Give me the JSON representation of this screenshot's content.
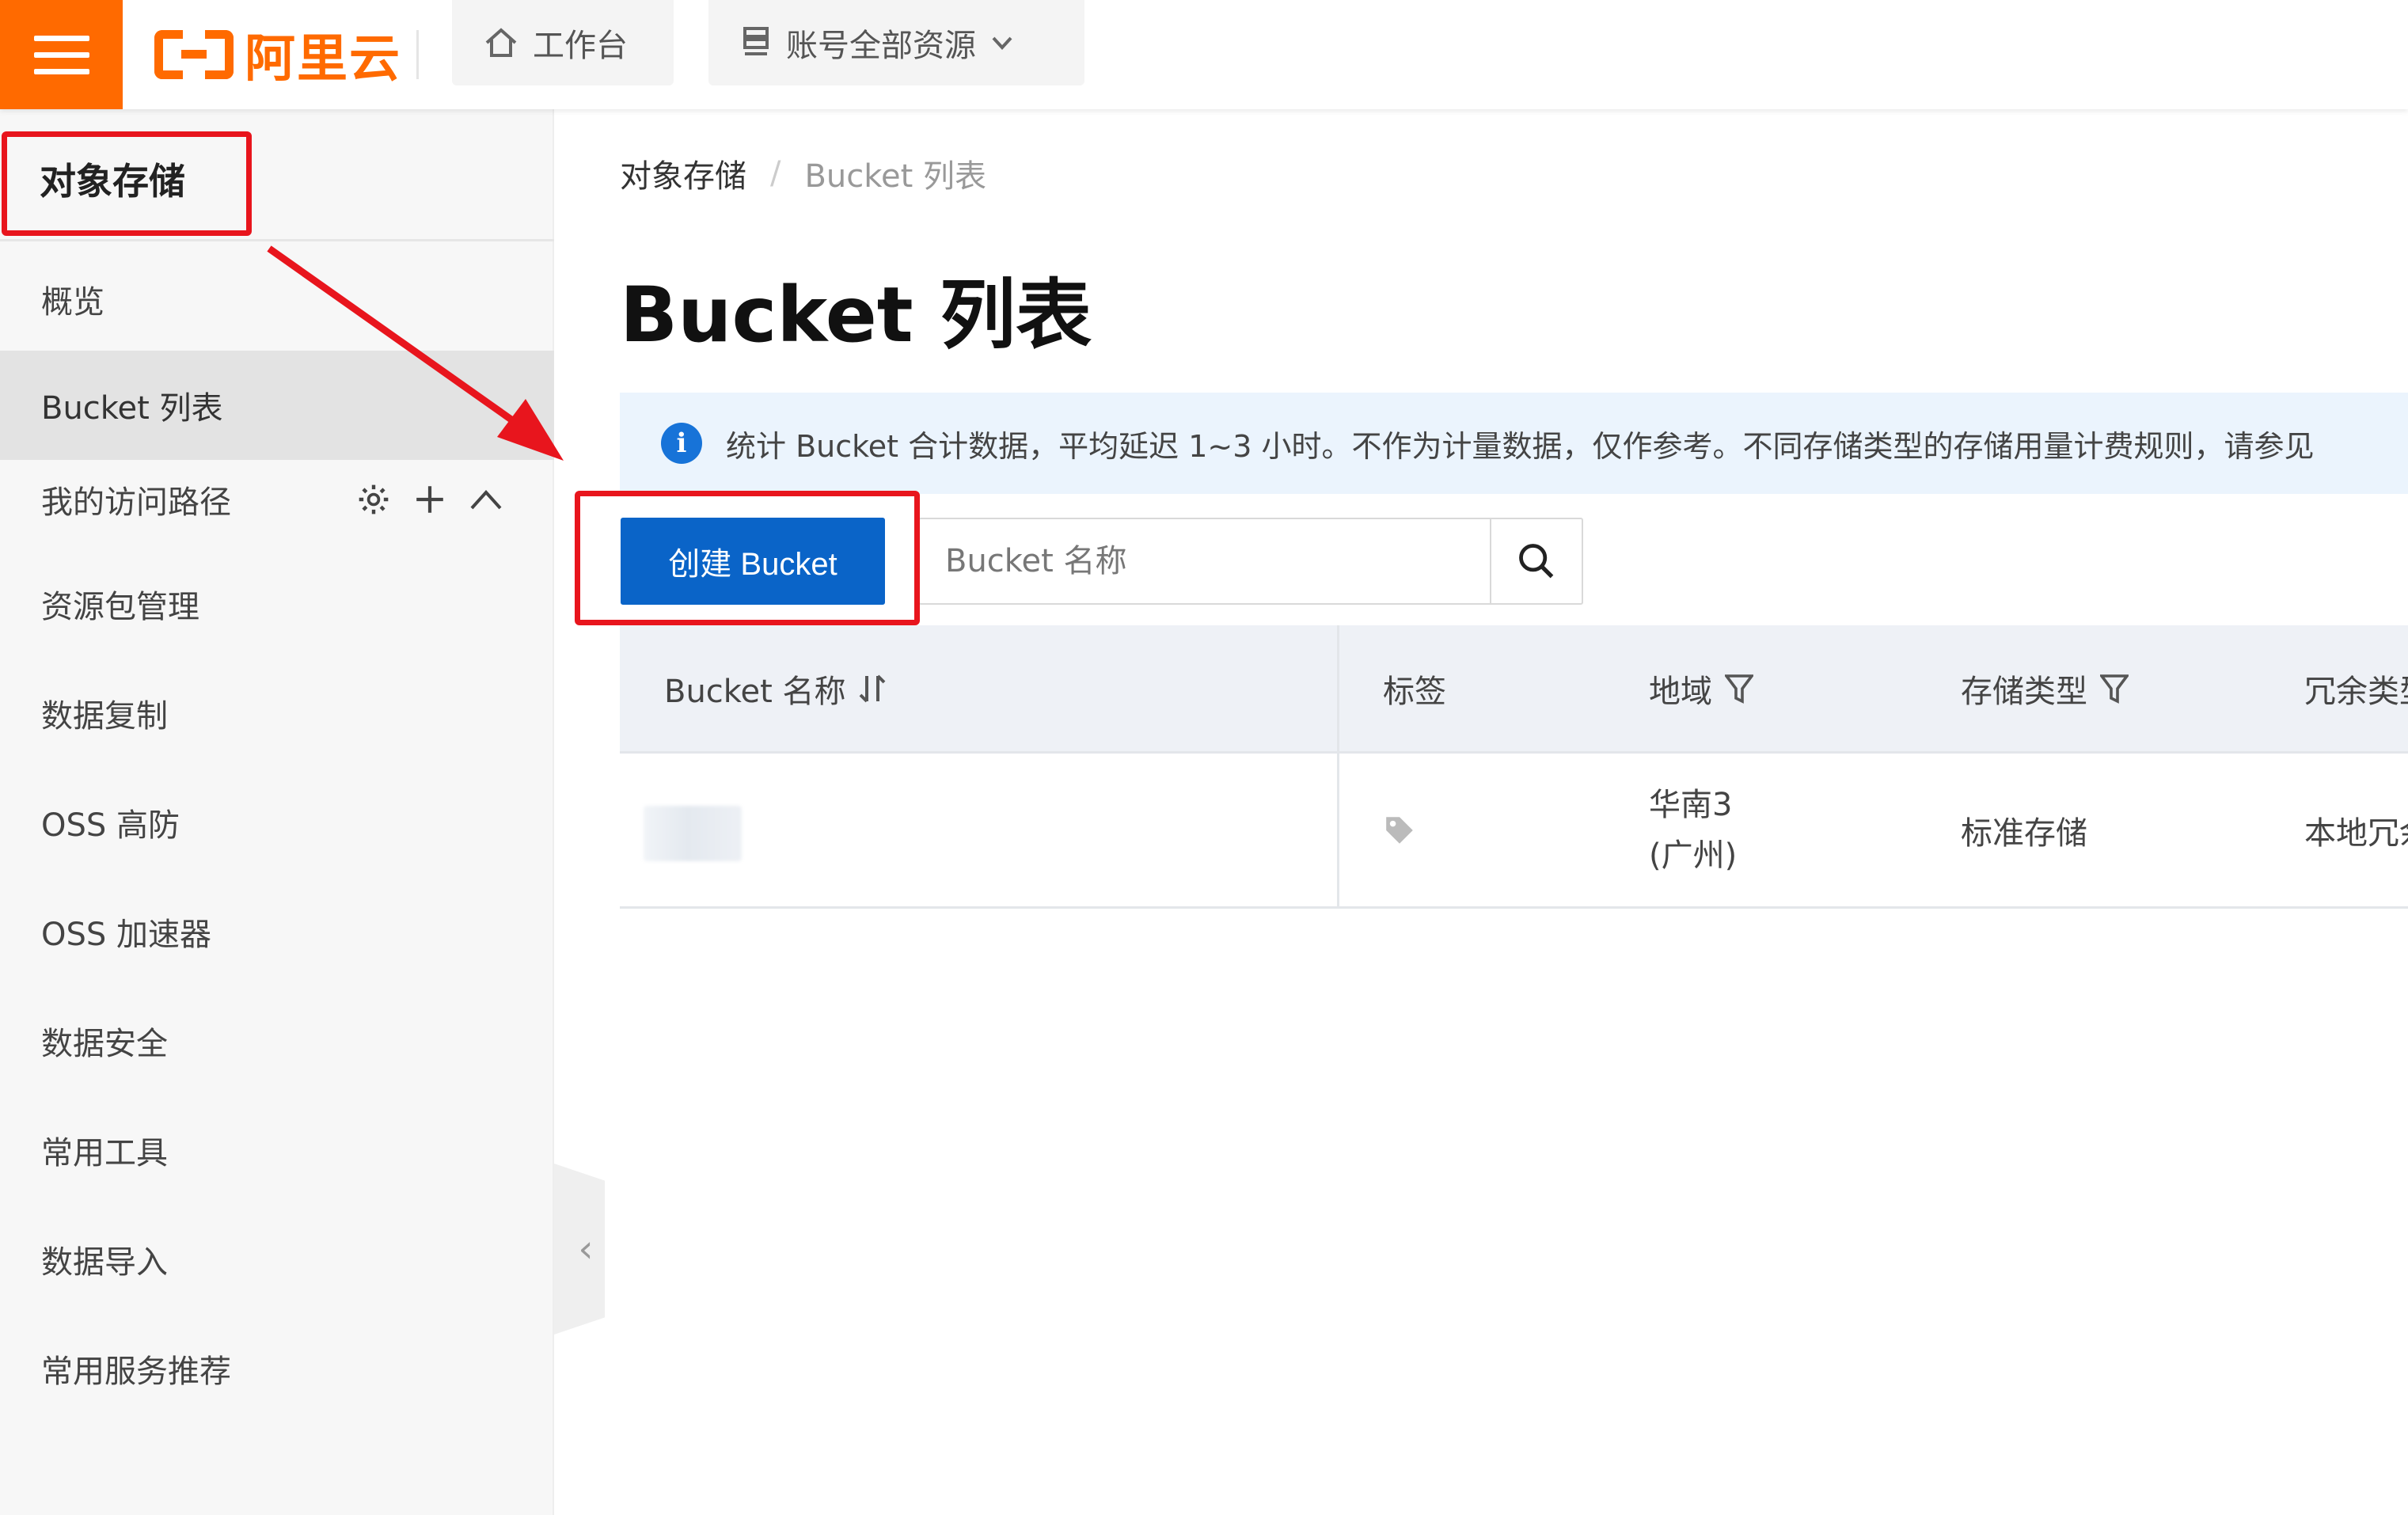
{
  "topbar": {
    "logo_text": "阿里云",
    "workbench_label": "工作台",
    "resources_label": "账号全部资源"
  },
  "sidebar": {
    "title": "对象存储",
    "items": [
      {
        "label": "概览"
      },
      {
        "label": "Bucket 列表",
        "active": true
      },
      {
        "label": "我的访问路径"
      },
      {
        "label": "资源包管理"
      },
      {
        "label": "数据复制"
      },
      {
        "label": "OSS 高防"
      },
      {
        "label": "OSS 加速器"
      },
      {
        "label": "数据安全"
      },
      {
        "label": "常用工具"
      },
      {
        "label": "数据导入"
      },
      {
        "label": "常用服务推荐"
      }
    ]
  },
  "breadcrumb": [
    "对象存储",
    "Bucket 列表"
  ],
  "page_title": "Bucket 列表",
  "notice": "统计 Bucket 合计数据，平均延迟 1~3 小时。不作为计量数据，仅作参考。不同存储类型的存储用量计费规则，请参见",
  "toolbar": {
    "create_label": "创建 Bucket",
    "search_placeholder": "Bucket 名称"
  },
  "table": {
    "columns": [
      "Bucket 名称",
      "标签",
      "地域",
      "存储类型",
      "冗余类型"
    ],
    "rows": [
      {
        "region_line1": "华南3",
        "region_line2": "(广州)",
        "storage_type": "标准存储",
        "redundancy": "本地冗余"
      }
    ]
  },
  "colors": {
    "brand": "#ff6a00",
    "primary": "#0a64c8",
    "annotation": "#e8151d"
  }
}
